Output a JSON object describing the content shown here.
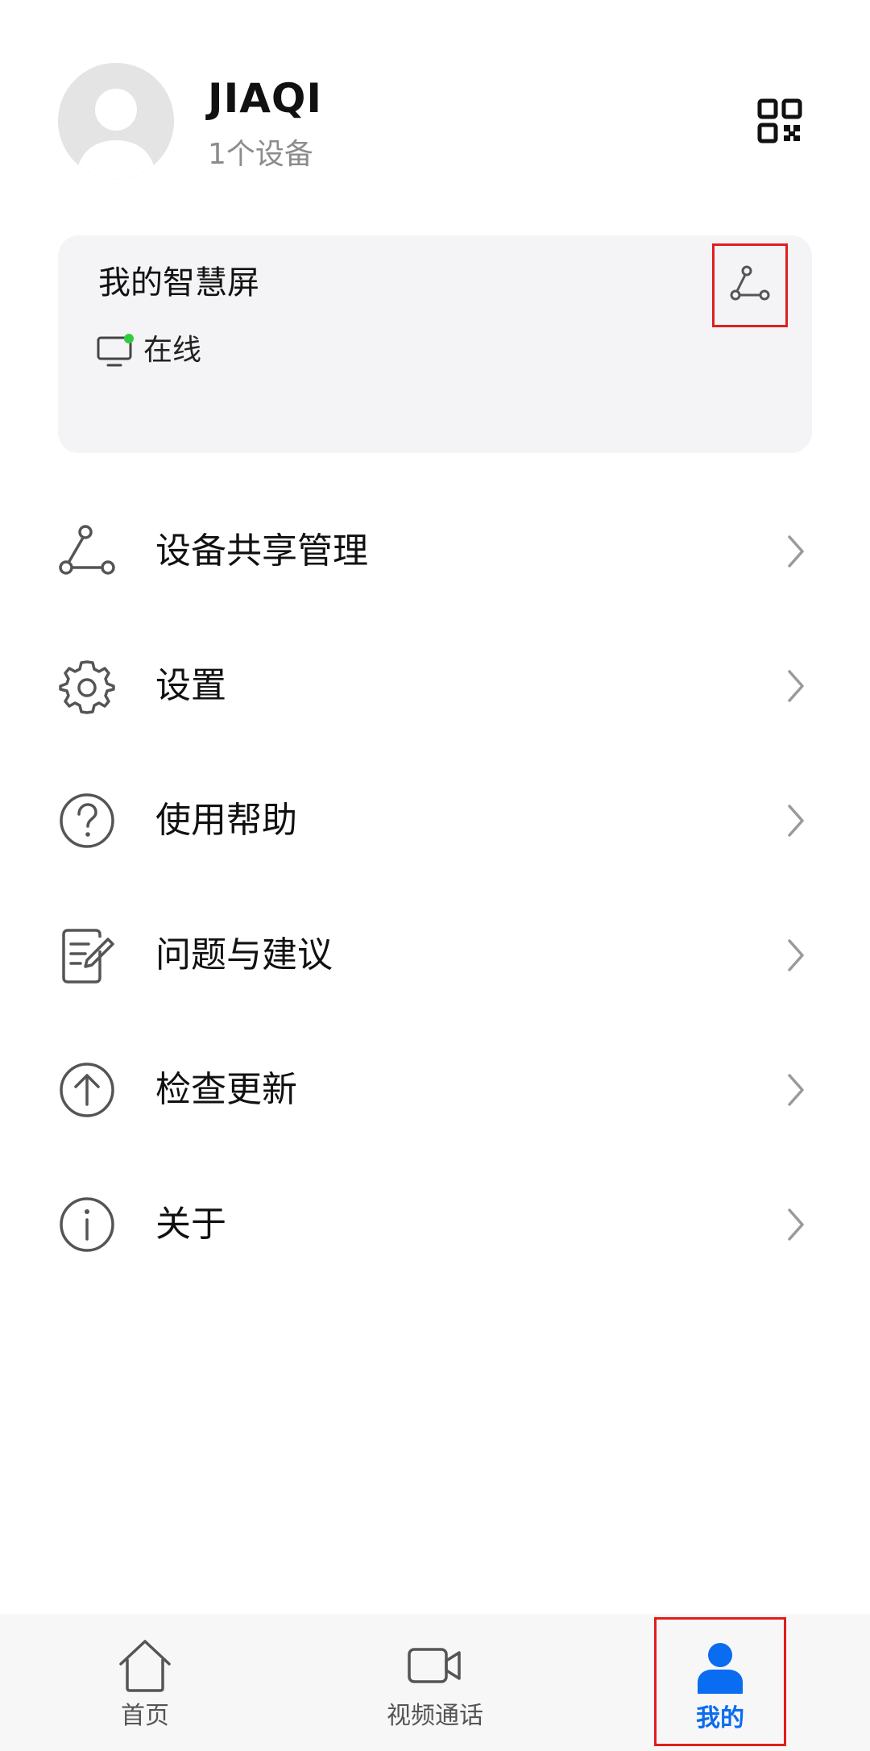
{
  "profile": {
    "username": "JIAQI",
    "device_count": "1个设备",
    "avatar_icon": "default-avatar-icon",
    "qr_icon": "qr-code-icon"
  },
  "device_card": {
    "name": "我的智慧屏",
    "status": "在线",
    "status_color": "#2ecc40",
    "tv_icon": "tv-icon",
    "share_icon": "share-icon"
  },
  "menu": {
    "items": [
      {
        "label": "设备共享管理",
        "icon": "share-icon"
      },
      {
        "label": "设置",
        "icon": "gear-icon"
      },
      {
        "label": "使用帮助",
        "icon": "help-icon"
      },
      {
        "label": "问题与建议",
        "icon": "feedback-icon"
      },
      {
        "label": "检查更新",
        "icon": "update-icon"
      },
      {
        "label": "关于",
        "icon": "info-icon"
      }
    ]
  },
  "bottom_nav": {
    "items": [
      {
        "label": "首页",
        "icon": "home-icon"
      },
      {
        "label": "视频通话",
        "icon": "video-call-icon"
      },
      {
        "label": "我的",
        "icon": "person-icon",
        "active": true
      }
    ],
    "active_color": "#0a6cf0"
  }
}
